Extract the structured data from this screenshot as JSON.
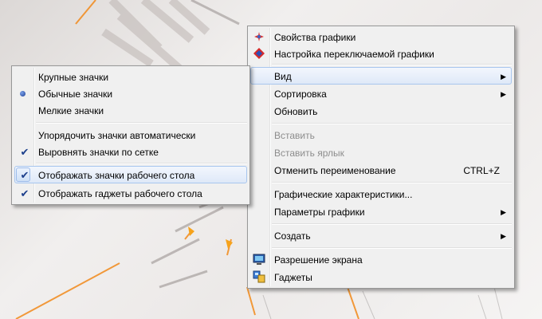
{
  "main_menu": {
    "items": [
      {
        "label": "Свойства графики",
        "icon": "intel-graphics-icon"
      },
      {
        "label": "Настройка переключаемой графики",
        "icon": "switchable-graphics-icon"
      },
      {
        "label": "Вид",
        "submenu": true
      },
      {
        "label": "Сортировка",
        "submenu": true
      },
      {
        "label": "Обновить"
      },
      {
        "label": "Вставить",
        "disabled": true
      },
      {
        "label": "Вставить ярлык",
        "disabled": true
      },
      {
        "label": "Отменить переименование",
        "shortcut": "CTRL+Z"
      },
      {
        "label": "Графические характеристики..."
      },
      {
        "label": "Параметры графики",
        "submenu": true
      },
      {
        "label": "Создать",
        "submenu": true
      },
      {
        "label": "Разрешение экрана",
        "icon": "screen-resolution-icon"
      },
      {
        "label": "Гаджеты",
        "icon": "gadgets-icon"
      }
    ],
    "arrow": "▶"
  },
  "view_submenu": {
    "items": [
      {
        "label": "Крупные значки"
      },
      {
        "label": "Обычные значки",
        "mark": "●"
      },
      {
        "label": "Мелкие значки"
      },
      {
        "label": "Упорядочить значки автоматически"
      },
      {
        "label": "Выровнять значки по сетке",
        "mark": "✔"
      },
      {
        "label": "Отображать значки рабочего стола",
        "mark": "✔"
      },
      {
        "label": "Отображать гаджеты  рабочего стола",
        "mark": "✔"
      }
    ]
  },
  "colors": {
    "highlight": "#dfe9f8",
    "highlight_border": "#a8c6ee",
    "check": "#1c3f8c",
    "accent": "#f28a1a"
  }
}
